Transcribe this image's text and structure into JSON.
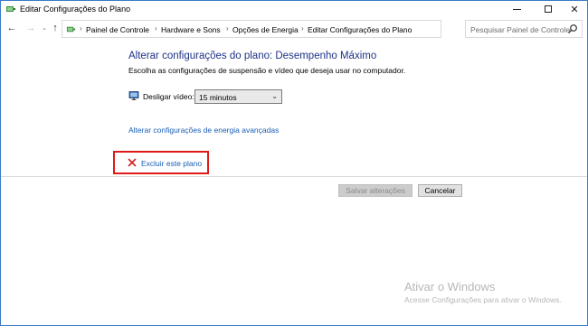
{
  "window": {
    "title": "Editar Configurações do Plano",
    "minimize_glyph": "—",
    "maximize_glyph": "☐",
    "close_glyph": "✕"
  },
  "nav": {
    "back_glyph": "←",
    "forward_glyph": "→",
    "dropdown_glyph": "⌄",
    "up_glyph": "↑"
  },
  "breadcrumb": {
    "separator": "›",
    "parts": [
      "Painel de Controle",
      "Hardware e Sons",
      "Opções de Energia",
      "Editar Configurações do Plano"
    ]
  },
  "search": {
    "placeholder": "Pesquisar Painel de Controle"
  },
  "content": {
    "heading": "Alterar configurações do plano: Desempenho Máximo",
    "subtext": "Escolha as configurações de suspensão e vídeo que deseja usar no computador.",
    "display_label": "Desligar vídeo:",
    "display_value": "15 minutos",
    "display_arrow": "⌄",
    "advanced_link": "Alterar configurações de energia avançadas",
    "delete_link": "Excluir este plano"
  },
  "buttons": {
    "save": "Salvar alterações",
    "cancel": "Cancelar"
  },
  "watermark": {
    "title": "Ativar o Windows",
    "subtitle": "Acesse Configurações para ativar o Windows."
  },
  "colors": {
    "heading": "#1e3287",
    "link": "#1a5fb4",
    "highlight_border": "#e01a1a"
  },
  "icons": {
    "app": "power-options-icon",
    "monitor": "monitor-icon",
    "delete": "delete-x-icon",
    "search": "search-icon"
  }
}
